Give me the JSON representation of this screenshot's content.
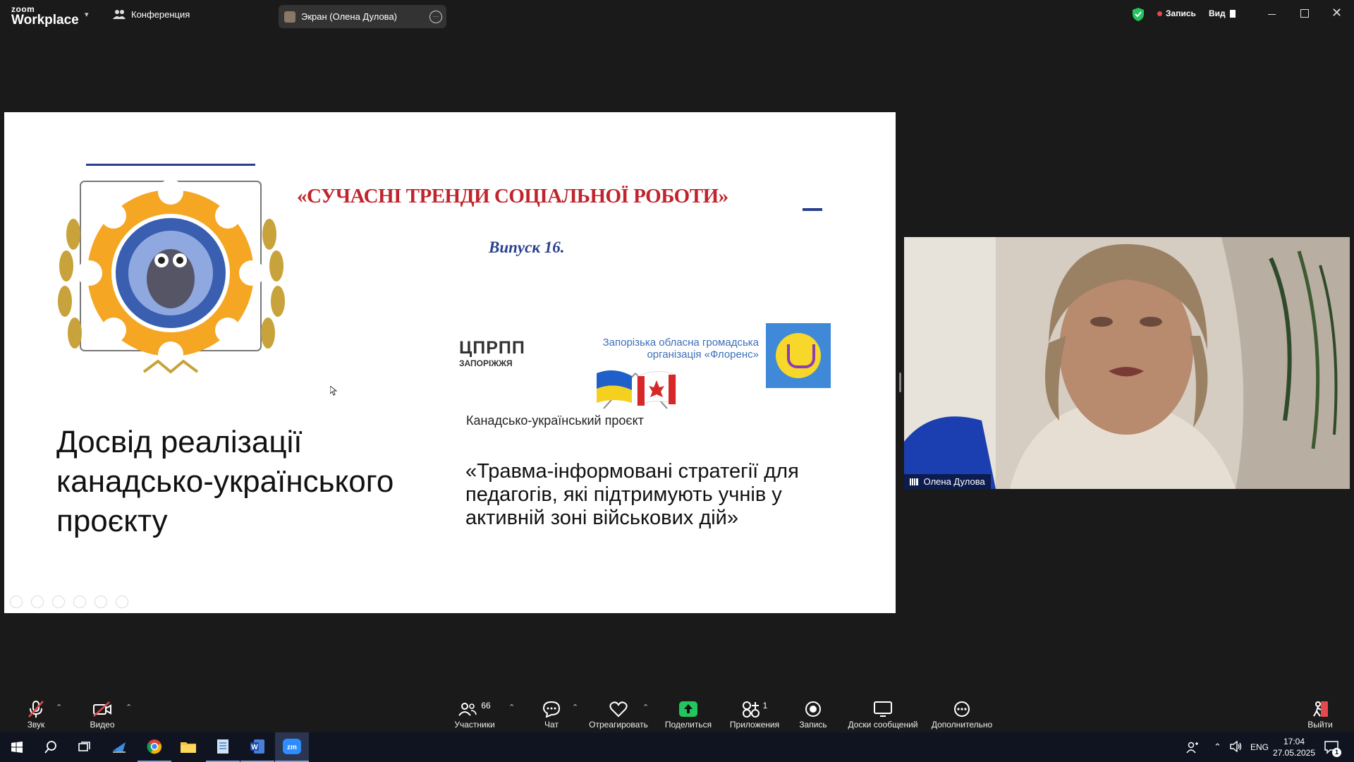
{
  "app": {
    "logo_small": "zoom",
    "logo_big": "Workplace",
    "meeting_label": "Конференция",
    "screen_tab": "Экран (Олена Дулова)",
    "record_label": "Запись",
    "view_label": "Вид"
  },
  "slide": {
    "title": "«СУЧАСНІ ТРЕНДИ СОЦІАЛЬНОЇ РОБОТИ»",
    "issue": "Випуск 16.",
    "logo_cprpp": "ЦПРПП",
    "logo_cprpp_sub": "ЗАПОРІЖЖЯ",
    "org_line1": "Запорізька обласна громадська",
    "org_line2": "організація «Флоренс»",
    "project_label": "Канадсько-український проєкт",
    "heading_line1": "Досвід реалізації",
    "heading_line2": "канадсько-українського",
    "heading_line3": "проєкту",
    "quote_line1": "«Травма-інформовані стратегії для",
    "quote_line2": "педагогів, які підтримують учнів у",
    "quote_line3": "активній зоні військових дій»"
  },
  "video": {
    "participant_name": "Олена Дулова"
  },
  "toolbar": {
    "audio": "Звук",
    "video": "Видео",
    "participants": "Участники",
    "participants_count": "66",
    "chat": "Чат",
    "react": "Отреагировать",
    "share": "Поделиться",
    "apps": "Приложения",
    "apps_count": "1",
    "record": "Запись",
    "boards": "Доски сообщений",
    "more": "Дополнительно",
    "leave": "Выйти"
  },
  "taskbar": {
    "lang": "ENG",
    "time": "17:04",
    "date": "27.05.2025",
    "notif_count": "1"
  },
  "colors": {
    "share_green": "#22c55e",
    "record_red": "#e5484d",
    "shield_green": "#22c55e",
    "title_red": "#c0242c"
  }
}
